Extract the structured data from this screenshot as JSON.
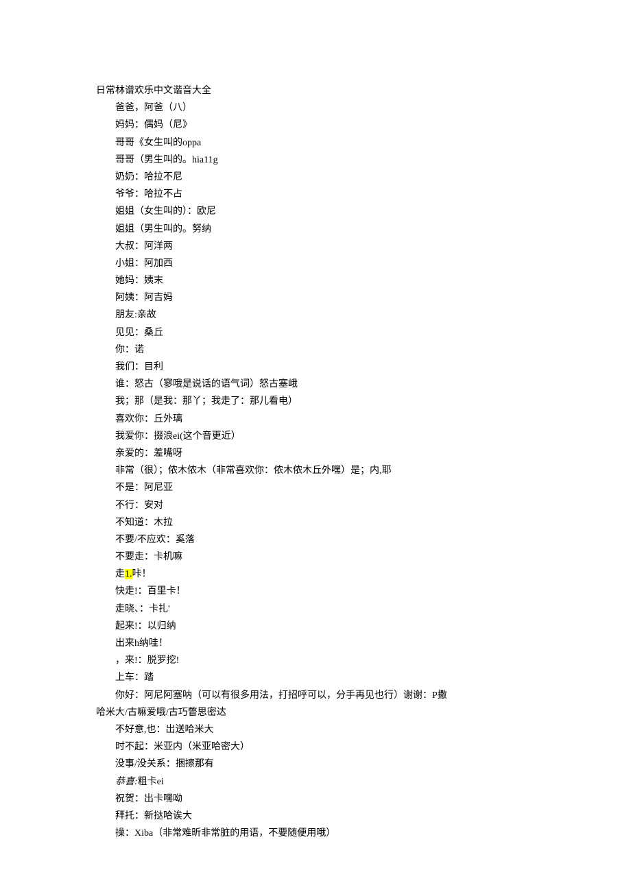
{
  "title": "日常林谱欢乐中文谐音大全",
  "items": [
    {
      "text": "爸爸，阿爸（八）"
    },
    {
      "text": "妈妈：偶妈（尼》"
    },
    {
      "text": "哥哥《女生叫的oppa"
    },
    {
      "text": "哥哥（男生叫的。hia11g"
    },
    {
      "text": "奶奶：哈拉不尼"
    },
    {
      "text": "爷爷：哈拉不占"
    },
    {
      "text": "姐姐（女生叫的）：欧尼"
    },
    {
      "text": "姐姐（男生叫的。努纳"
    },
    {
      "text": "大叔：阿洋两"
    },
    {
      "text": "小姐：阿加西"
    },
    {
      "text": "她妈：姨末"
    },
    {
      "text": "阿姨：阿吉妈"
    },
    {
      "text": "朋友:亲故"
    },
    {
      "text": "见见：桑丘"
    },
    {
      "text": "你：诺"
    },
    {
      "text": "我们：目利"
    },
    {
      "text": "谁：怒古（寥哦是说话的语气词）怒古塞峨"
    },
    {
      "text": "我；那（是我：那丫；我走了：那儿看电）"
    },
    {
      "text": "喜欢你：丘外璃"
    },
    {
      "text": "我爱你：掇浪ei(这个音更近）"
    },
    {
      "text": "亲爱的：差嘴呀"
    },
    {
      "text": "非常（很）；侬木侬木（非常喜欢你：侬木侬木丘外嘿）是；内,耶"
    },
    {
      "text": "不是：阿尼亚"
    },
    {
      "text": "不行：安对"
    },
    {
      "text": "不知道：木拉"
    },
    {
      "text": "不要/不应欢：奚落"
    },
    {
      "text": "不要走：卡机嘛"
    },
    {
      "text": "走",
      "highlightChar": "1.",
      "suffix": "咔！"
    },
    {
      "text": "快走!：百里卡！"
    },
    {
      "text": "走晓、：卡扎'"
    },
    {
      "text": "起来!：以归纳"
    },
    {
      "text": "出来h纳哇！"
    },
    {
      "text": "，来!：脱罗挖!"
    },
    {
      "text": "上车：踏"
    },
    {
      "text": "你好：阿尼阿塞呐（可以有很多用法，打招呼可以，分手再见也行）谢谢：P撒"
    }
  ],
  "continuation": "哈米大/古嘛爱哦/古巧瞥思密达",
  "items2": [
    {
      "text": "不好意,也：出送哈米大"
    },
    {
      "text": "时不起：米亚内（米亚哈密大）"
    },
    {
      "text": "没事/没关系：捆擦那有"
    },
    {
      "italicPrefix": "恭喜:",
      "text": "粗卡ei"
    },
    {
      "text": "祝贺：出卡嘿呦"
    },
    {
      "text": "拜托：新挞哈诶大"
    },
    {
      "text": "操：Xiba（非常难昕非常脏的用语，不要随便用哦）"
    }
  ]
}
